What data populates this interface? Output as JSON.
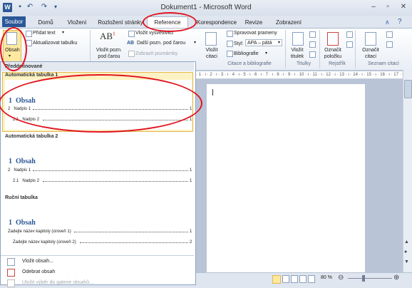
{
  "window": {
    "title": "Dokument1 - Microsoft Word",
    "app_icon_letter": "W"
  },
  "tabs": [
    "Soubor",
    "Domů",
    "Vložení",
    "Rozložení stránky",
    "Reference",
    "Korespondence",
    "Revize",
    "Zobrazení"
  ],
  "ribbon": {
    "toc_button": "Obsah",
    "add_text": "Přidat text",
    "update_table": "Aktualizovat tabulku",
    "insert_footnote_line1": "Vložit pozn.",
    "insert_footnote_line2": "pod čarou",
    "insert_endnote": "Vložit vysvětlivku",
    "next_footnote": "Další pozn. pod čarou",
    "show_notes": "Zobrazit poznámky",
    "insert_citation_line1": "Vložit",
    "insert_citation_line2": "citaci",
    "manage_sources": "Spravovat prameny",
    "style_label": "Styl:",
    "style_value": "APA – pátá",
    "bibliography": "Bibliografie",
    "group_citations": "Citace a bibliografie",
    "insert_caption_line1": "Vložit",
    "insert_caption_line2": "titulek",
    "group_captions": "Titulky",
    "mark_entry_line1": "Označit",
    "mark_entry_line2": "položku",
    "group_index": "Rejstřík",
    "mark_citation_line1": "Označit",
    "mark_citation_line2": "citaci",
    "group_toa": "Seznam citací"
  },
  "dropdown": {
    "section_builtin": "Předdefinované",
    "auto_table_1": "Automatická tabulka 1",
    "auto_table_2": "Automatická tabulka 2",
    "manual_table": "Ruční tabulka",
    "toc_heading": "Obsah",
    "toc_heading_num": "1",
    "auto_lines": [
      {
        "num": "2",
        "text": "Nadpis 1",
        "page": "1"
      },
      {
        "num": "2.1",
        "text": "Nadpis 2",
        "page": "1"
      }
    ],
    "manual_lines": [
      {
        "text": "Zadejte název kapitoly (úroveň 1)",
        "page": "1"
      },
      {
        "text": "Zadejte název kapitoly (úroveň 2)",
        "page": "2"
      }
    ],
    "menu_insert_toc": "Vložit obsah...",
    "menu_remove_toc": "Odebrat obsah",
    "menu_save_selection": "Uložit výběr do galerie obsahů..."
  },
  "status": {
    "zoom": "80 %"
  },
  "colors": {
    "accent": "#2b5797",
    "annotation": "#e0141e",
    "highlight": "#fde9a0"
  }
}
